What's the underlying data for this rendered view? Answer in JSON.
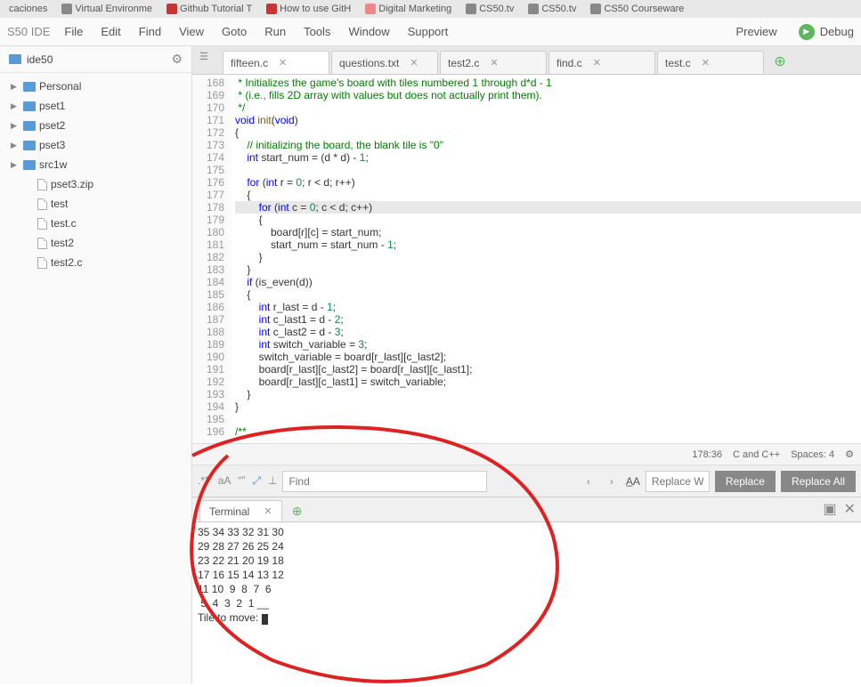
{
  "browser_tabs": [
    {
      "label": "caciones"
    },
    {
      "label": "Virtual Environme"
    },
    {
      "label": "Github Tutorial T"
    },
    {
      "label": "How to use GitH"
    },
    {
      "label": "Digital Marketing"
    },
    {
      "label": "CS50.tv"
    },
    {
      "label": "CS50.tv"
    },
    {
      "label": "CS50 Courseware"
    }
  ],
  "app_title": "S50 IDE",
  "menu": [
    "File",
    "Edit",
    "Find",
    "View",
    "Goto",
    "Run",
    "Tools",
    "Window",
    "Support"
  ],
  "preview_label": "Preview",
  "debug_label": "Debug",
  "sidebar_root": "ide50",
  "tree": [
    {
      "label": "Personal",
      "type": "folder"
    },
    {
      "label": "pset1",
      "type": "folder"
    },
    {
      "label": "pset2",
      "type": "folder"
    },
    {
      "label": "pset3",
      "type": "folder"
    },
    {
      "label": "src1w",
      "type": "folder"
    },
    {
      "label": "pset3.zip",
      "type": "file",
      "nested": true
    },
    {
      "label": "test",
      "type": "file",
      "nested": true
    },
    {
      "label": "test.c",
      "type": "file",
      "nested": true
    },
    {
      "label": "test2",
      "type": "file",
      "nested": true
    },
    {
      "label": "test2.c",
      "type": "file",
      "nested": true
    }
  ],
  "tabs": [
    {
      "label": "fifteen.c",
      "active": true
    },
    {
      "label": "questions.txt"
    },
    {
      "label": "test2.c"
    },
    {
      "label": "find.c"
    },
    {
      "label": "test.c"
    }
  ],
  "line_start": 168,
  "line_end": 196,
  "highlighted_line": 178,
  "status": {
    "cursor": "178:36",
    "lang": "C and C++",
    "spaces": "Spaces: 4"
  },
  "find": {
    "placeholder": "Find",
    "replace_placeholder": "Replace W"
  },
  "replace_label": "Replace",
  "replace_all_label": "Replace All",
  "terminal_tab": "Terminal",
  "terminal_output": "35 34 33 32 31 30\n29 28 27 26 25 24\n23 22 21 20 19 18\n17 16 15 14 13 12\n11 10  9  8  7  6\n 5  4  3  2  1 __",
  "terminal_prompt": "Tile to move: "
}
